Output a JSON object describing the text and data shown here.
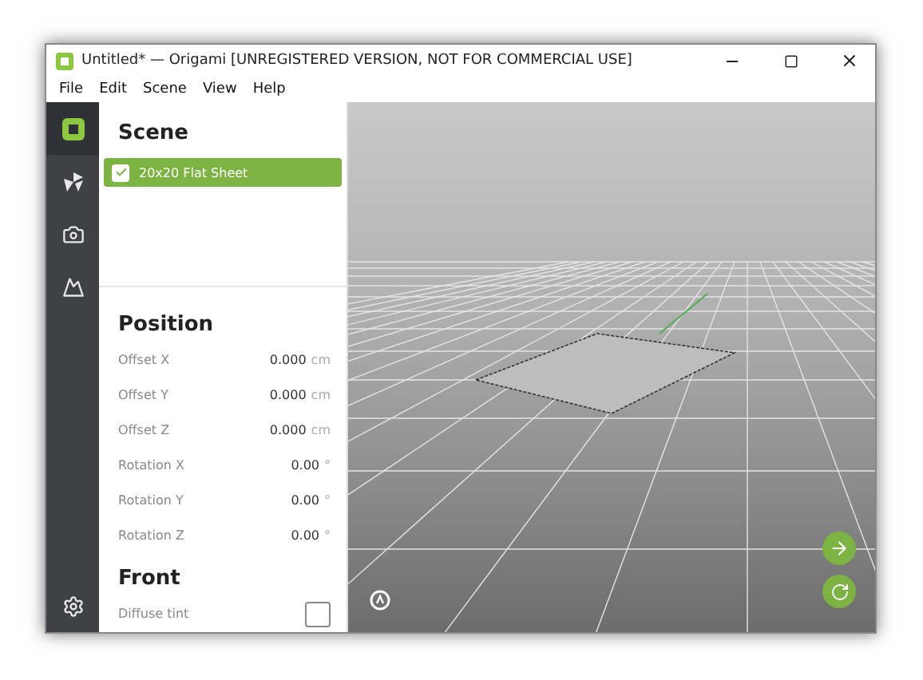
{
  "window": {
    "title": "Untitled* — Origami [UNREGISTERED VERSION, NOT FOR COMMERCIAL USE]"
  },
  "menu": [
    "File",
    "Edit",
    "Scene",
    "View",
    "Help"
  ],
  "sidebar": {
    "items": [
      {
        "kind": "object",
        "selected": true
      },
      {
        "kind": "fold",
        "selected": false
      },
      {
        "kind": "camera",
        "selected": false
      },
      {
        "kind": "export",
        "selected": false
      }
    ]
  },
  "scene": {
    "title": "Scene",
    "items": [
      {
        "label": "20x20 Flat Sheet",
        "checked": true,
        "selected": true
      }
    ]
  },
  "position": {
    "title": "Position",
    "fields": [
      {
        "label": "Offset X",
        "value": "0.000",
        "unit": "cm"
      },
      {
        "label": "Offset Y",
        "value": "0.000",
        "unit": "cm"
      },
      {
        "label": "Offset Z",
        "value": "0.000",
        "unit": "cm"
      },
      {
        "label": "Rotation X",
        "value": "0.00",
        "unit": "°"
      },
      {
        "label": "Rotation Y",
        "value": "0.00",
        "unit": "°"
      },
      {
        "label": "Rotation Z",
        "value": "0.00",
        "unit": "°"
      }
    ]
  },
  "front": {
    "title": "Front",
    "fields": [
      {
        "label": "Diffuse tint",
        "checked": false
      }
    ]
  }
}
